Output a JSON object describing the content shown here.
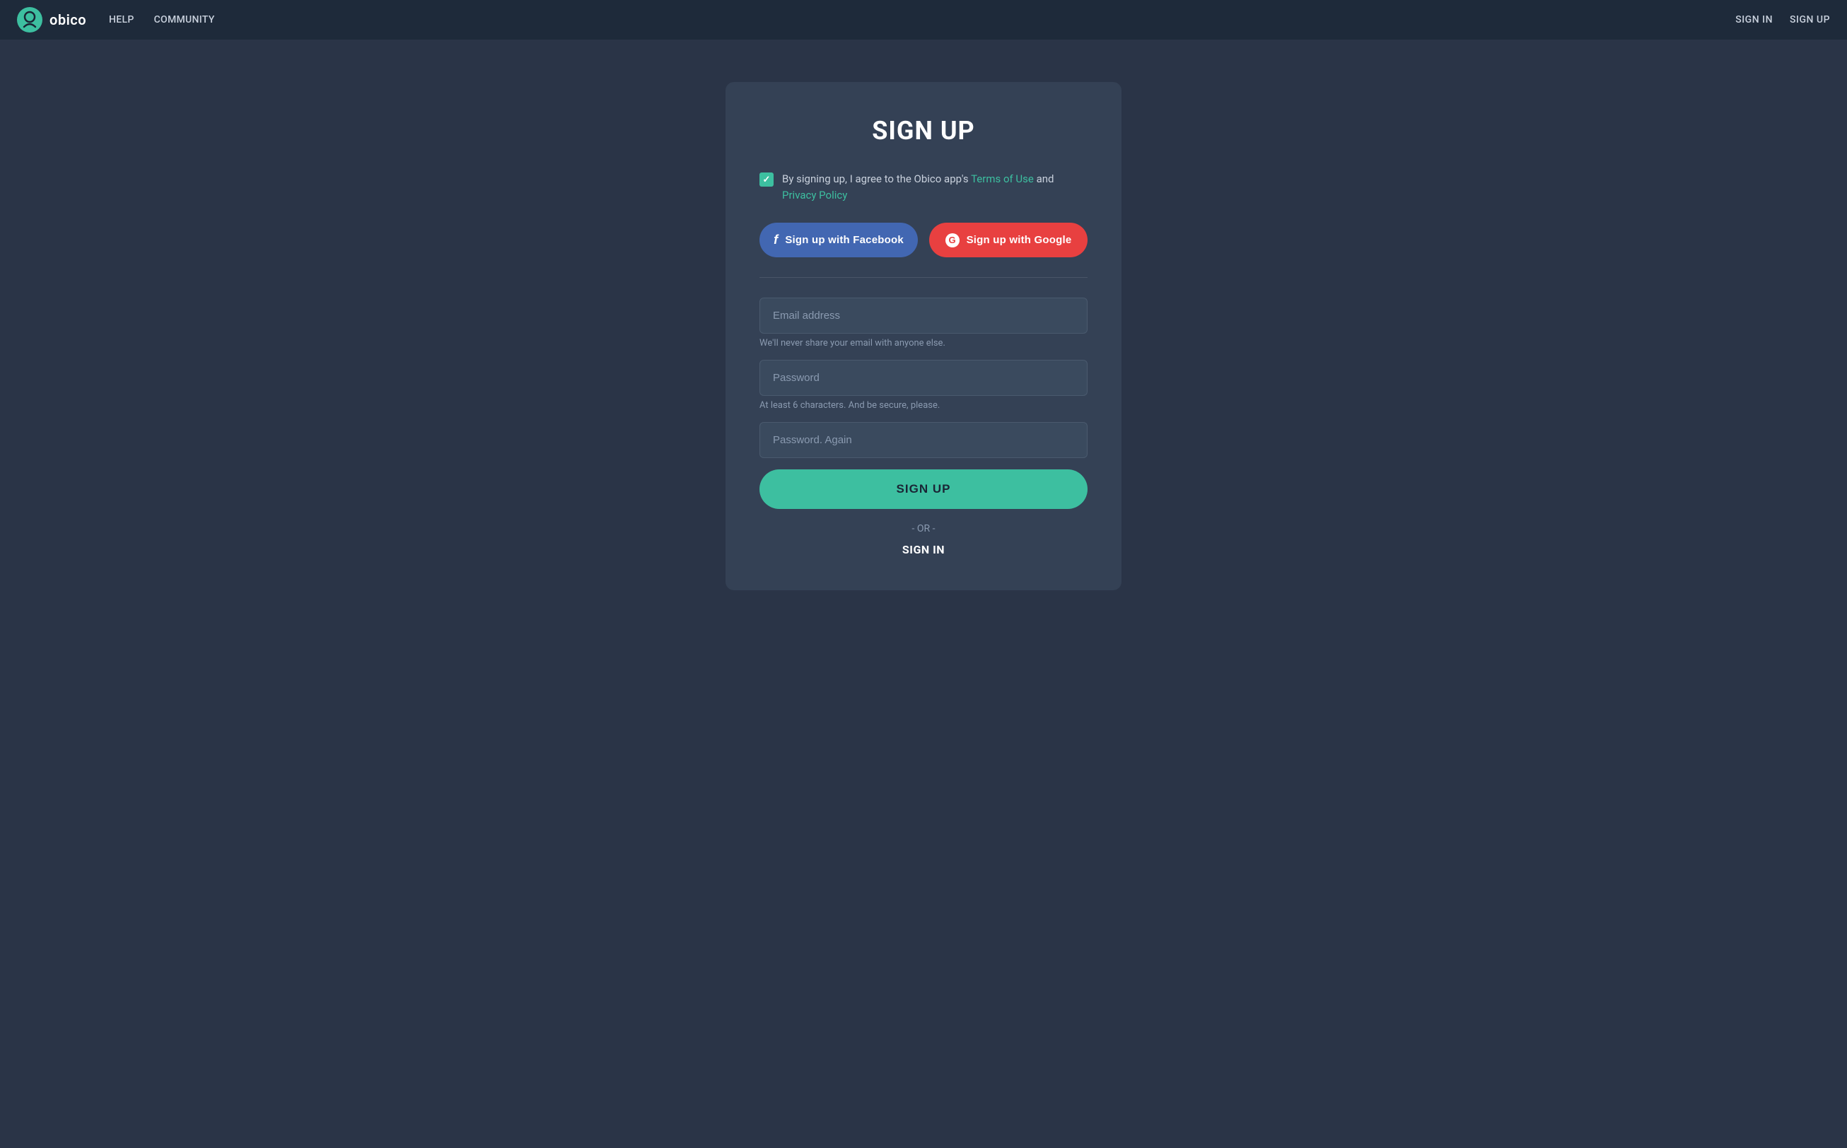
{
  "navbar": {
    "logo_text": "obico",
    "nav_links": [
      {
        "label": "HELP",
        "id": "help"
      },
      {
        "label": "COMMUNITY",
        "id": "community"
      }
    ],
    "auth_links": [
      {
        "label": "SIGN IN",
        "id": "signin"
      },
      {
        "label": "SIGN UP",
        "id": "signup"
      }
    ]
  },
  "signup_card": {
    "title": "SIGN UP",
    "terms_text_before": "By signing up, I agree to the Obico app's",
    "terms_of_use": "Terms of Use",
    "terms_text_and": "and",
    "privacy_policy": "Privacy Policy",
    "facebook_button": "Sign up with Facebook",
    "google_button": "Sign up with Google",
    "email_placeholder": "Email address",
    "email_hint": "We'll never share your email with anyone else.",
    "password_placeholder": "Password",
    "password_hint": "At least 6 characters. And be secure, please.",
    "password_again_placeholder": "Password. Again",
    "signup_button": "SIGN UP",
    "or_text": "- OR -",
    "signin_link": "SIGN IN"
  },
  "colors": {
    "teal": "#3dbfa0",
    "facebook_blue": "#4267b2",
    "google_red": "#e84040",
    "bg_dark": "#2a3447",
    "card_bg": "#344155",
    "navbar_bg": "#1e2a3a"
  }
}
